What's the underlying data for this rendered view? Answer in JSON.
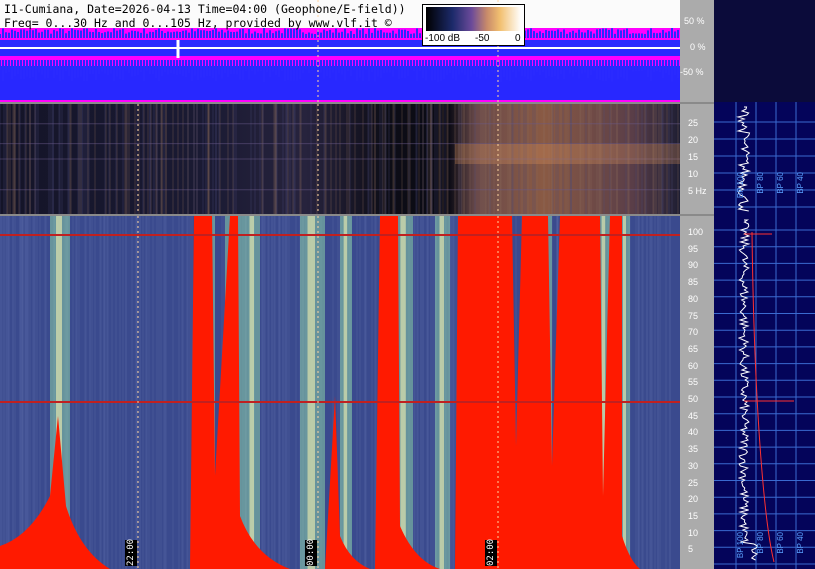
{
  "header": {
    "title_line": "I1-Cumiana, Date=2026-04-13 Time=04:00 (Geophone/E-field))",
    "freq_line": "Freq= 0...30 Hz and 0...105 Hz, provided by www.vlf.it ©"
  },
  "colorbar": {
    "ticks": [
      "-100 dB",
      "-50",
      "0"
    ]
  },
  "amplitude_axis": {
    "labels": [
      "50 %",
      "0 %",
      "-50 %"
    ]
  },
  "spec30_axis": {
    "labels": [
      "25",
      "20",
      "15",
      "10",
      "5 Hz"
    ]
  },
  "spec105_axis": {
    "labels": [
      "100",
      "95",
      "90",
      "85",
      "80",
      "75",
      "70",
      "65",
      "60",
      "55",
      "50",
      "45",
      "40",
      "35",
      "30",
      "25",
      "20",
      "15",
      "10",
      "5"
    ]
  },
  "time_labels": [
    "22:00",
    "00:00",
    "02:00"
  ],
  "spectrum_panel": {
    "bp_top": [
      "BP 100",
      "BP 80",
      "BP 60",
      "BP 40",
      "BP 20"
    ],
    "bp_bottom": [
      "BP 100",
      "BP 80",
      "BP 60",
      "BP 40",
      "BP 20"
    ]
  },
  "colors": {
    "magenta": "#ff00ff",
    "blue": "#2a2aff",
    "saturation_red": "#ff1a00",
    "background_spec": "#3a4a8e",
    "axis_gray": "#ababab",
    "spectrum_bg": "#04045a"
  },
  "icons": {
    "copyright": "copyright-icon"
  }
}
